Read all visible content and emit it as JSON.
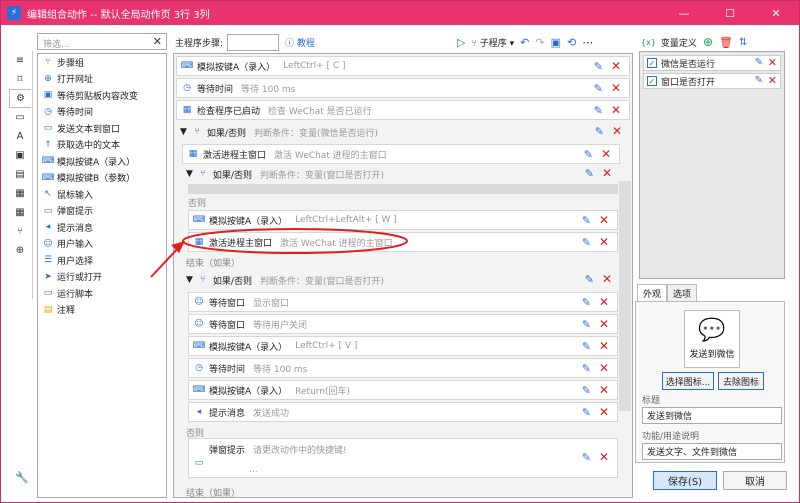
{
  "window": {
    "title": "编辑组合动作 -- 默认全局动作页 3行 3列",
    "min": "—",
    "max": "☐",
    "close": "✕"
  },
  "rail": {
    "icons": [
      "list-icon",
      "bookmark-icon",
      "gear-icon",
      "window-icon",
      "text-icon",
      "clipboard-icon",
      "document-icon",
      "windows-icon",
      "keyboard-icon",
      "branch-icon",
      "globe-icon"
    ],
    "glyphs": [
      "≡",
      "⌑",
      "⚙",
      "▭",
      "A",
      "▣",
      "▤",
      "▦",
      "▦",
      "⑂",
      "⊕"
    ]
  },
  "search": {
    "placeholder": "筛选...",
    "clear": "✕"
  },
  "tools": [
    {
      "label": "步骤组",
      "glyph": "⑂"
    },
    {
      "label": "打开网址",
      "glyph": "⊕"
    },
    {
      "label": "等待剪贴板内容改变",
      "glyph": "▣"
    },
    {
      "label": "等待时间",
      "glyph": "◷"
    },
    {
      "label": "发送文本到窗口",
      "glyph": "▭"
    },
    {
      "label": "获取选中的文本",
      "glyph": "↑"
    },
    {
      "label": "模拟按键A（录入）",
      "glyph": "⌨"
    },
    {
      "label": "模拟按键B（参数）",
      "glyph": "⌨"
    },
    {
      "label": "鼠标输入",
      "glyph": "↖"
    },
    {
      "label": "弹窗提示",
      "glyph": "▭"
    },
    {
      "label": "提示消息",
      "glyph": "◂"
    },
    {
      "label": "用户输入",
      "glyph": "☺"
    },
    {
      "label": "用户选择",
      "glyph": "☰"
    },
    {
      "label": "运行或打开",
      "glyph": "➤"
    },
    {
      "label": "运行脚本",
      "glyph": "▭"
    },
    {
      "label": "注释",
      "glyph": "▤"
    }
  ],
  "main": {
    "steps_label": "主程序步骤:",
    "tutorial": "教程",
    "subprogram": "子程序",
    "steps": [
      {
        "name": "模拟按键A（录入）",
        "desc": "LeftCtrl+ [ C ]",
        "glyph": "⌨"
      },
      {
        "name": "等待时间",
        "desc": "等待 100 ms",
        "glyph": "◷"
      },
      {
        "name": "检查程序已启动",
        "desc": "检查 WeChat 是否已运行",
        "glyph": "▦"
      },
      {
        "name": "如果/否则",
        "desc": "判断条件：变量(微信是否运行)",
        "glyph": "⑂",
        "toggle": "▼"
      },
      {
        "name": "激活进程主窗口",
        "desc": "激活 WeChat 进程的主窗口",
        "glyph": "▦"
      },
      {
        "name": "如果/否则",
        "desc": "判断条件：变量(窗口是否打开)",
        "glyph": "⑂",
        "toggle": "▼"
      },
      {
        "name": "模拟按键A（录入）",
        "desc": "LeftCtrl+LeftAlt+ [ W ]",
        "glyph": "⌨"
      },
      {
        "name": "激活进程主窗口",
        "desc": "激活 WeChat 进程的主窗口",
        "glyph": "▦"
      },
      {
        "name": "如果/否则",
        "desc": "判断条件：变量(窗口是否打开)",
        "glyph": "⑂",
        "toggle": "▼"
      },
      {
        "name": "等待窗口",
        "desc": "显示窗口",
        "glyph": "☺"
      },
      {
        "name": "等待窗口",
        "desc": "等待用户关闭",
        "glyph": "☺"
      },
      {
        "name": "模拟按键A（录入）",
        "desc": "LeftCtrl+ [ V ]",
        "glyph": "⌨"
      },
      {
        "name": "等待时间",
        "desc": "等待 100 ms",
        "glyph": "◷"
      },
      {
        "name": "模拟按键A（录入）",
        "desc": "Return(回车)",
        "glyph": "⌨"
      },
      {
        "name": "提示消息",
        "desc": "发送成功",
        "glyph": "◂"
      },
      {
        "name": "弹窗提示",
        "desc": "请更改动作中的快捷键!",
        "glyph": "▭"
      }
    ],
    "else_label": "否则",
    "end_if_label": "结束（如果）",
    "extra_desc": "...",
    "cut_label": "结束（如果）"
  },
  "vars": {
    "header": "变量定义",
    "items": [
      {
        "name": "微信是否运行",
        "checked": "✓"
      },
      {
        "name": "窗口是否打开",
        "checked": "✓"
      }
    ]
  },
  "props": {
    "tab_appearance": "外观",
    "tab_options": "选项",
    "icon_caption": "发送到微信",
    "choose_icon": "选择图标...",
    "remove_icon": "去除图标",
    "title_label": "标题",
    "title_value": "发送到微信",
    "desc_label": "功能/用途说明",
    "desc_value": "发送文字、文件到微信"
  },
  "footer": {
    "save": "保存(S)",
    "cancel": "取消"
  },
  "colors": {
    "titlebar": "#e8336f",
    "accent": "#2b6fd6",
    "delete": "#e02020",
    "annotation": "#e02020"
  }
}
